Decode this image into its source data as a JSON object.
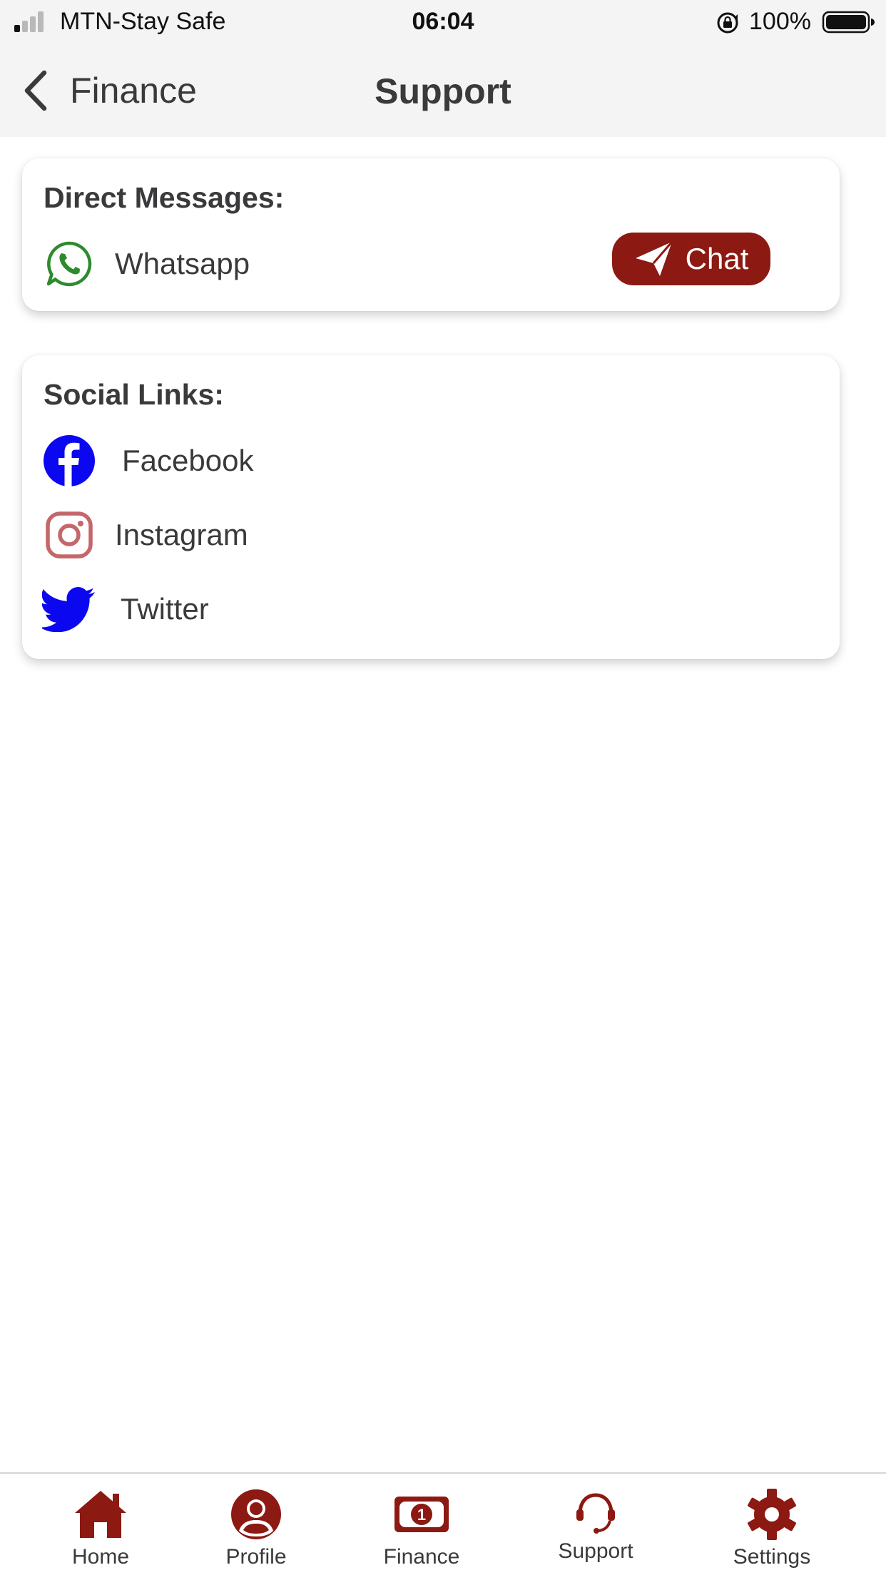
{
  "status_bar": {
    "carrier": "MTN-Stay Safe",
    "time": "06:04",
    "battery_percent": "100%"
  },
  "nav": {
    "back_label": "Finance",
    "title": "Support"
  },
  "direct_messages": {
    "heading": "Direct Messages:",
    "item": {
      "label": "Whatsapp",
      "icon": "whatsapp-icon"
    },
    "chat_button_label": "Chat"
  },
  "social_links": {
    "heading": "Social Links:",
    "items": [
      {
        "label": "Facebook",
        "icon": "facebook-icon"
      },
      {
        "label": "Instagram",
        "icon": "instagram-icon"
      },
      {
        "label": "Twitter",
        "icon": "twitter-icon"
      }
    ]
  },
  "tab_bar": {
    "items": [
      {
        "label": "Home",
        "icon": "home-icon"
      },
      {
        "label": "Profile",
        "icon": "profile-icon"
      },
      {
        "label": "Finance",
        "icon": "money-bill-icon"
      },
      {
        "label": "Support",
        "icon": "headset-icon"
      },
      {
        "label": "Settings",
        "icon": "gear-icon"
      }
    ]
  },
  "colors": {
    "accent": "#8c1912",
    "whatsapp": "#2d8a2d",
    "facebook": "#0b07f0",
    "instagram": "#c4666a",
    "twitter": "#0b07f0",
    "text": "#3a3a3c",
    "bar_background": "#f4f4f4"
  }
}
